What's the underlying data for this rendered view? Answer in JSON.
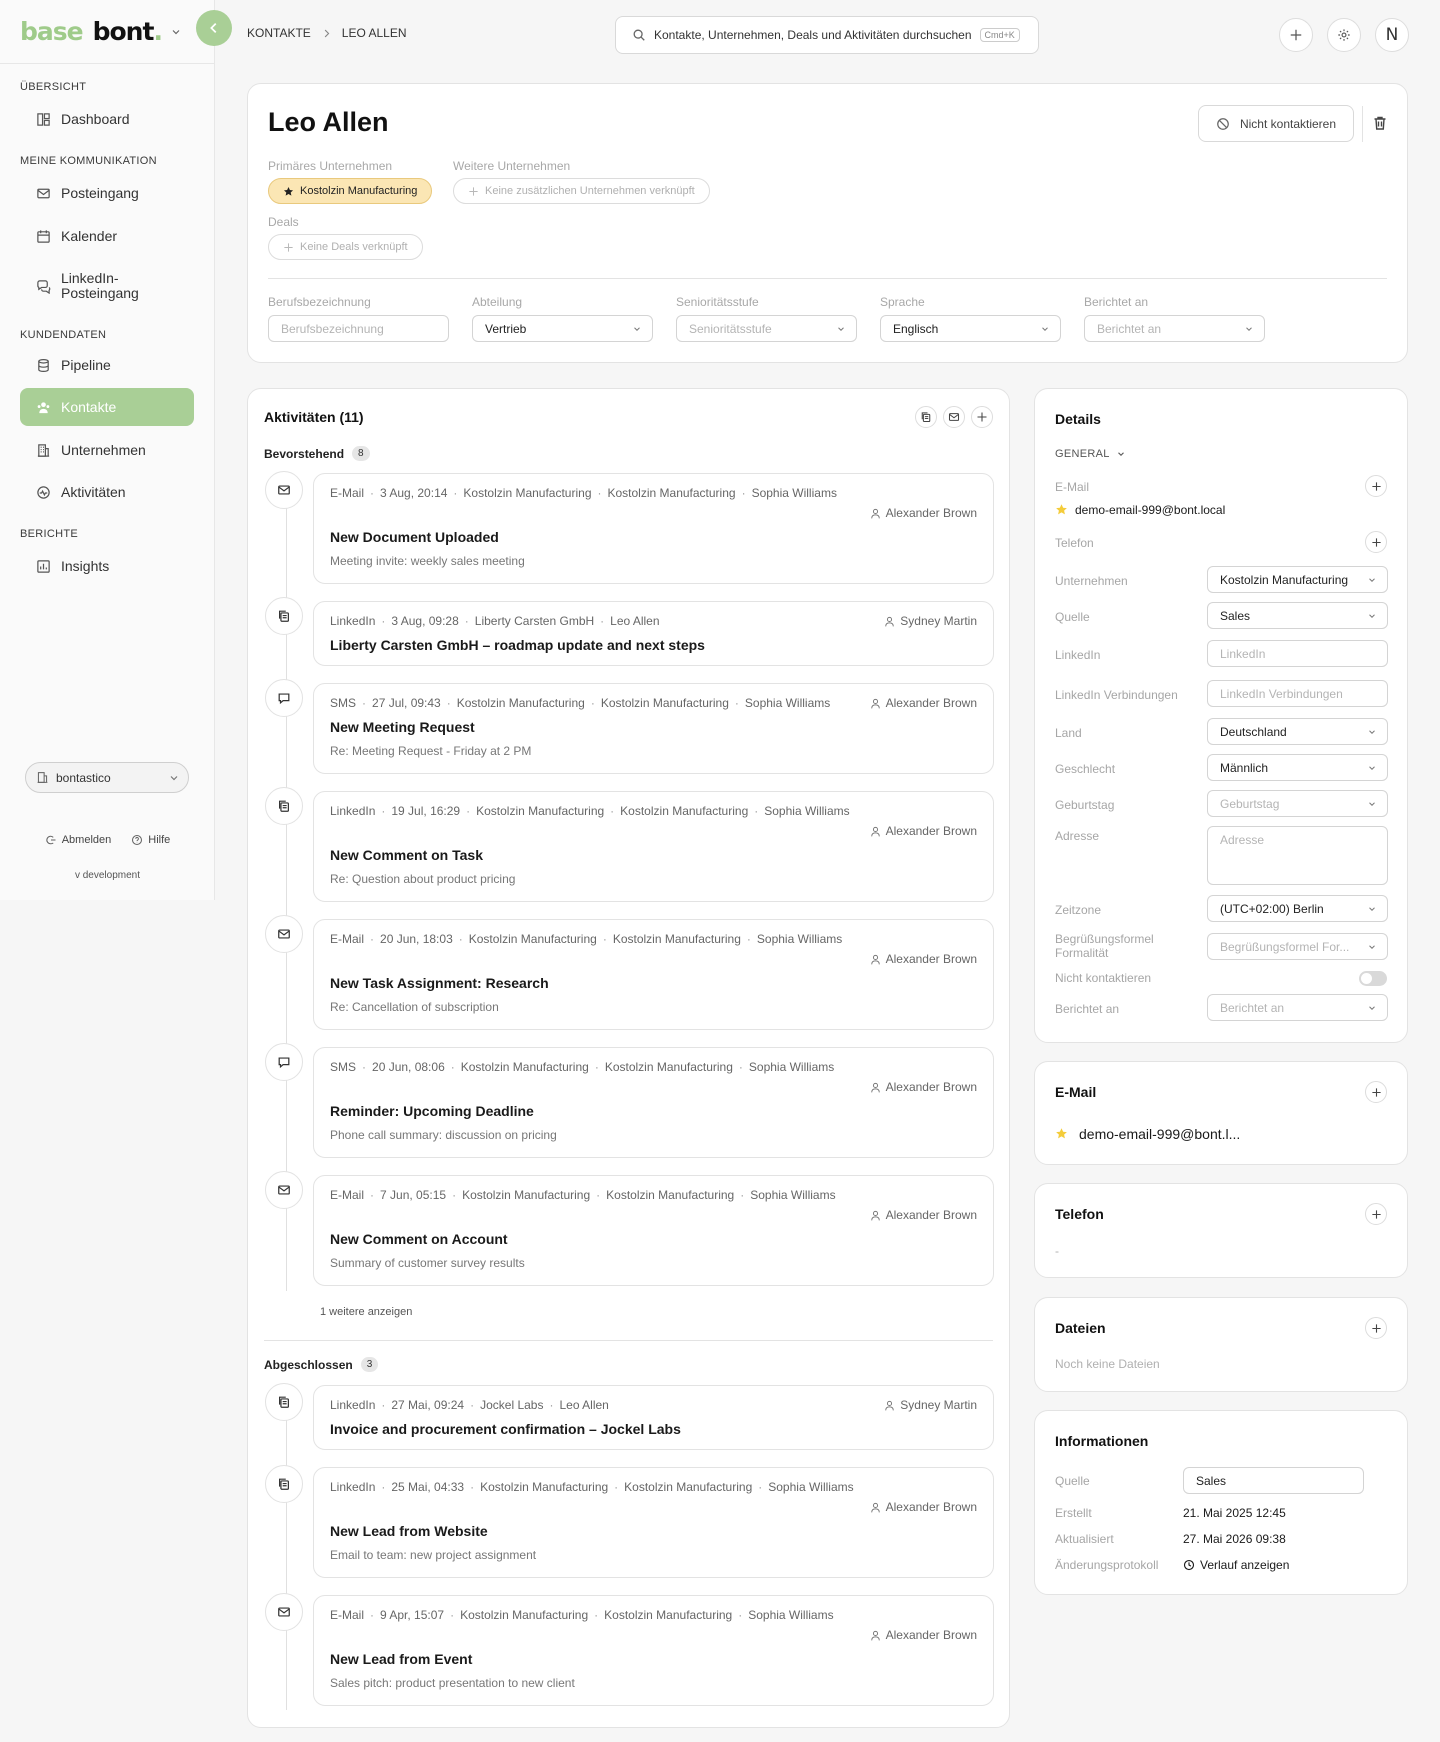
{
  "app": {
    "logo_part1": "base",
    "logo_part2": "bont",
    "logo_dot": "."
  },
  "sidebar": {
    "sections": [
      {
        "title": "Übersicht",
        "items": [
          {
            "label": "Dashboard",
            "icon": "dashboard-icon"
          }
        ]
      },
      {
        "title": "Meine Kommunikation",
        "items": [
          {
            "label": "Posteingang",
            "icon": "mail-icon"
          },
          {
            "label": "Kalender",
            "icon": "calendar-icon"
          },
          {
            "label": "LinkedIn-Posteingang",
            "icon": "chat-icon"
          }
        ]
      },
      {
        "title": "Kundendaten",
        "items": [
          {
            "label": "Pipeline",
            "icon": "database-icon"
          },
          {
            "label": "Kontakte",
            "icon": "contacts-icon",
            "active": true
          },
          {
            "label": "Unternehmen",
            "icon": "building-icon"
          },
          {
            "label": "Aktivitäten",
            "icon": "activity-icon"
          }
        ]
      },
      {
        "title": "Berichte",
        "items": [
          {
            "label": "Insights",
            "icon": "chart-icon"
          }
        ]
      }
    ],
    "workspace": "bontastico",
    "logout": "Abmelden",
    "help": "Hilfe",
    "version": "v development"
  },
  "topbar": {
    "breadcrumb": [
      "Kontakte",
      "Leo Allen"
    ],
    "search_placeholder": "Kontakte, Unternehmen, Deals und Aktivitäten durchsuchen",
    "search_shortcut": "Cmd+K",
    "avatar_initial": "N"
  },
  "contact": {
    "name": "Leo Allen",
    "dnc_button": "Nicht kontaktieren",
    "primary_company_label": "Primäres Unternehmen",
    "primary_company": "Kostolzin Manufacturing",
    "other_companies_label": "Weitere Unternehmen",
    "other_companies_empty": "Keine zusätzlichen Unternehmen verknüpft",
    "deals_label": "Deals",
    "deals_empty": "Keine Deals verknüpft",
    "fields": {
      "job_title_label": "Berufsbezeichnung",
      "job_title_placeholder": "Berufsbezeichnung",
      "department_label": "Abteilung",
      "department_value": "Vertrieb",
      "seniority_label": "Senioritätsstufe",
      "seniority_placeholder": "Senioritätsstufe",
      "language_label": "Sprache",
      "language_value": "Englisch",
      "reports_to_label": "Berichtet an",
      "reports_to_placeholder": "Berichtet an"
    }
  },
  "activities": {
    "title": "Aktivitäten (11)",
    "upcoming_label": "Bevorstehend",
    "upcoming_count": "8",
    "completed_label": "Abgeschlossen",
    "completed_count": "3",
    "more_link": "1 weitere anzeigen",
    "upcoming": [
      {
        "type": "email",
        "meta": [
          "E-Mail",
          "3 Aug, 20:14",
          "Kostolzin Manufacturing",
          "Kostolzin Manufacturing",
          "Sophia Williams"
        ],
        "owner": "Alexander Brown",
        "subject": "New Document Uploaded",
        "body": "Meeting invite: weekly sales meeting"
      },
      {
        "type": "linkedin",
        "meta": [
          "LinkedIn",
          "3 Aug, 09:28",
          "Liberty Carsten GmbH",
          "Leo Allen"
        ],
        "owner": "Sydney Martin",
        "subject": "Liberty Carsten GmbH – roadmap update and next steps",
        "body": ""
      },
      {
        "type": "sms",
        "meta": [
          "SMS",
          "27 Jul, 09:43",
          "Kostolzin Manufacturing",
          "Kostolzin Manufacturing",
          "Sophia Williams"
        ],
        "owner": "Alexander Brown",
        "subject": "New Meeting Request",
        "body": "Re: Meeting Request - Friday at 2 PM"
      },
      {
        "type": "linkedin",
        "meta": [
          "LinkedIn",
          "19 Jul, 16:29",
          "Kostolzin Manufacturing",
          "Kostolzin Manufacturing",
          "Sophia Williams"
        ],
        "owner": "Alexander Brown",
        "subject": "New Comment on Task",
        "body": "Re: Question about product pricing"
      },
      {
        "type": "email",
        "meta": [
          "E-Mail",
          "20 Jun, 18:03",
          "Kostolzin Manufacturing",
          "Kostolzin Manufacturing",
          "Sophia Williams"
        ],
        "owner": "Alexander Brown",
        "subject": "New Task Assignment: Research",
        "body": "Re: Cancellation of subscription"
      },
      {
        "type": "sms",
        "meta": [
          "SMS",
          "20 Jun, 08:06",
          "Kostolzin Manufacturing",
          "Kostolzin Manufacturing",
          "Sophia Williams"
        ],
        "owner": "Alexander Brown",
        "subject": "Reminder: Upcoming Deadline",
        "body": "Phone call summary: discussion on pricing"
      },
      {
        "type": "email",
        "meta": [
          "E-Mail",
          "7 Jun, 05:15",
          "Kostolzin Manufacturing",
          "Kostolzin Manufacturing",
          "Sophia Williams"
        ],
        "owner": "Alexander Brown",
        "subject": "New Comment on Account",
        "body": "Summary of customer survey results"
      }
    ],
    "completed": [
      {
        "type": "linkedin",
        "meta": [
          "LinkedIn",
          "27 Mai, 09:24",
          "Jockel Labs",
          "Leo Allen"
        ],
        "owner": "Sydney Martin",
        "subject": "Invoice and procurement confirmation – Jockel Labs",
        "body": ""
      },
      {
        "type": "linkedin",
        "meta": [
          "LinkedIn",
          "25 Mai, 04:33",
          "Kostolzin Manufacturing",
          "Kostolzin Manufacturing",
          "Sophia Williams"
        ],
        "owner": "Alexander Brown",
        "subject": "New Lead from Website",
        "body": "Email to team: new project assignment"
      },
      {
        "type": "email",
        "meta": [
          "E-Mail",
          "9 Apr, 15:07",
          "Kostolzin Manufacturing",
          "Kostolzin Manufacturing",
          "Sophia Williams"
        ],
        "owner": "Alexander Brown",
        "subject": "New Lead from Event",
        "body": "Sales pitch: product presentation to new client"
      }
    ]
  },
  "details": {
    "title": "Details",
    "general": "General",
    "email_label": "E-Mail",
    "email_value": "demo-email-999@bont.local",
    "phone_label": "Telefon",
    "rows": [
      {
        "label": "Unternehmen",
        "value": "Kostolzin Manufacturing",
        "kind": "select"
      },
      {
        "label": "Quelle",
        "value": "Sales",
        "kind": "select"
      },
      {
        "label": "LinkedIn",
        "placeholder": "LinkedIn",
        "kind": "input"
      },
      {
        "label": "LinkedIn Verbindungen",
        "placeholder": "LinkedIn Verbindungen",
        "kind": "input"
      },
      {
        "label": "Land",
        "value": "Deutschland",
        "kind": "select"
      },
      {
        "label": "Geschlecht",
        "value": "Männlich",
        "kind": "select"
      },
      {
        "label": "Geburtstag",
        "placeholder": "Geburtstag",
        "kind": "select"
      },
      {
        "label": "Adresse",
        "placeholder": "Adresse",
        "kind": "textarea"
      },
      {
        "label": "Zeitzone",
        "value": "(UTC+02:00) Berlin",
        "kind": "select"
      },
      {
        "label": "Begrüßungsformel Formalität",
        "placeholder": "Begrüßungsformel For...",
        "kind": "select"
      },
      {
        "label": "Nicht kontaktieren",
        "kind": "toggle",
        "value": false
      },
      {
        "label": "Berichtet an",
        "placeholder": "Berichtet an",
        "kind": "select"
      }
    ]
  },
  "email_card": {
    "title": "E-Mail",
    "value": "demo-email-999@bont.l..."
  },
  "phone_card": {
    "title": "Telefon",
    "empty": "-"
  },
  "files_card": {
    "title": "Dateien",
    "empty": "Noch keine Dateien"
  },
  "info_card": {
    "title": "Informationen",
    "source_label": "Quelle",
    "source_value": "Sales",
    "created_label": "Erstellt",
    "created_value": "21. Mai 2025 12:45",
    "updated_label": "Aktualisiert",
    "updated_value": "27. Mai 2026 09:38",
    "log_label": "Änderungsprotokoll",
    "log_value": "Verlauf anzeigen"
  },
  "colors": {
    "accent": "#a9cf96",
    "primary_chip": "#fbe6b4",
    "star": "#f4cc3a"
  }
}
